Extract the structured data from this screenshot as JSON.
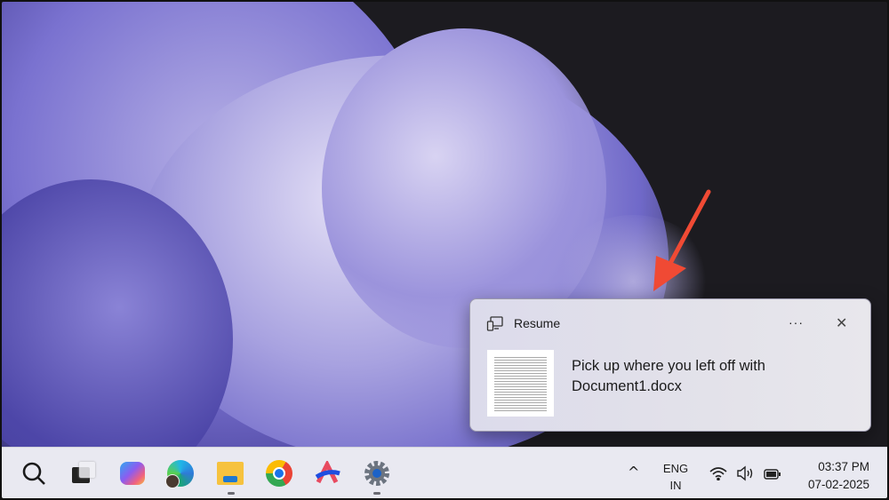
{
  "notification": {
    "app_name": "Resume",
    "message": "Pick up where you left off with Document1.docx",
    "more_label": "···",
    "close_label": "✕"
  },
  "taskbar": {
    "apps": [
      "search-icon",
      "task-view-icon",
      "copilot-icon",
      "edge-icon",
      "file-explorer-icon",
      "chrome-icon",
      "app-icon",
      "settings-icon"
    ],
    "tray": {
      "chevron": "^",
      "lang_line1": "ENG",
      "lang_line2": "IN",
      "time": "03:37 PM",
      "date": "07-02-2025"
    }
  },
  "colors": {
    "accent_arrow": "#f04a34",
    "wall_purple": "#6d67c8"
  }
}
